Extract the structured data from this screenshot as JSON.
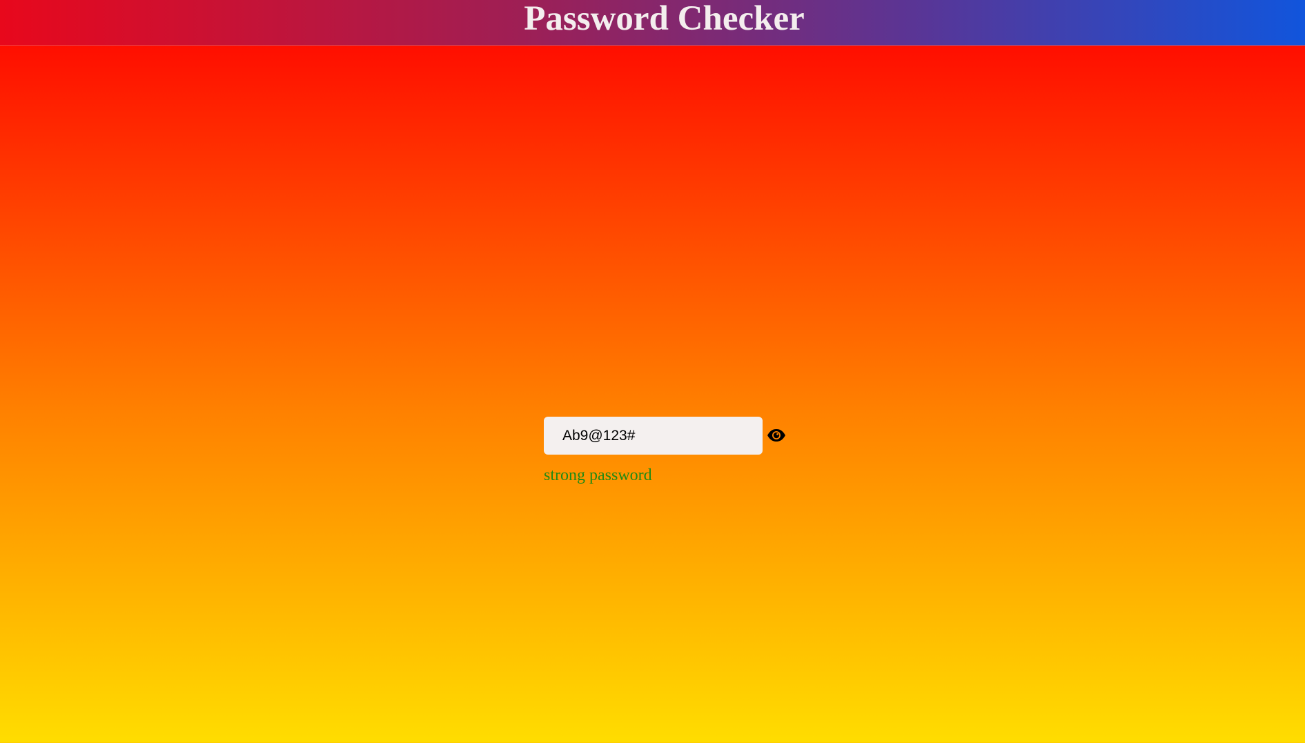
{
  "header": {
    "title": "Password Checker"
  },
  "form": {
    "password_value": "Ab9@123#",
    "toggle_icon": "eye-icon",
    "strength_text": "strong password",
    "strength_color": "#1f8a14"
  },
  "colors": {
    "background_top": "#ff0000",
    "background_mid": "#ff8000",
    "background_bottom": "#ffdd00",
    "header_left": "#e8081c",
    "header_right": "#1155dc"
  }
}
